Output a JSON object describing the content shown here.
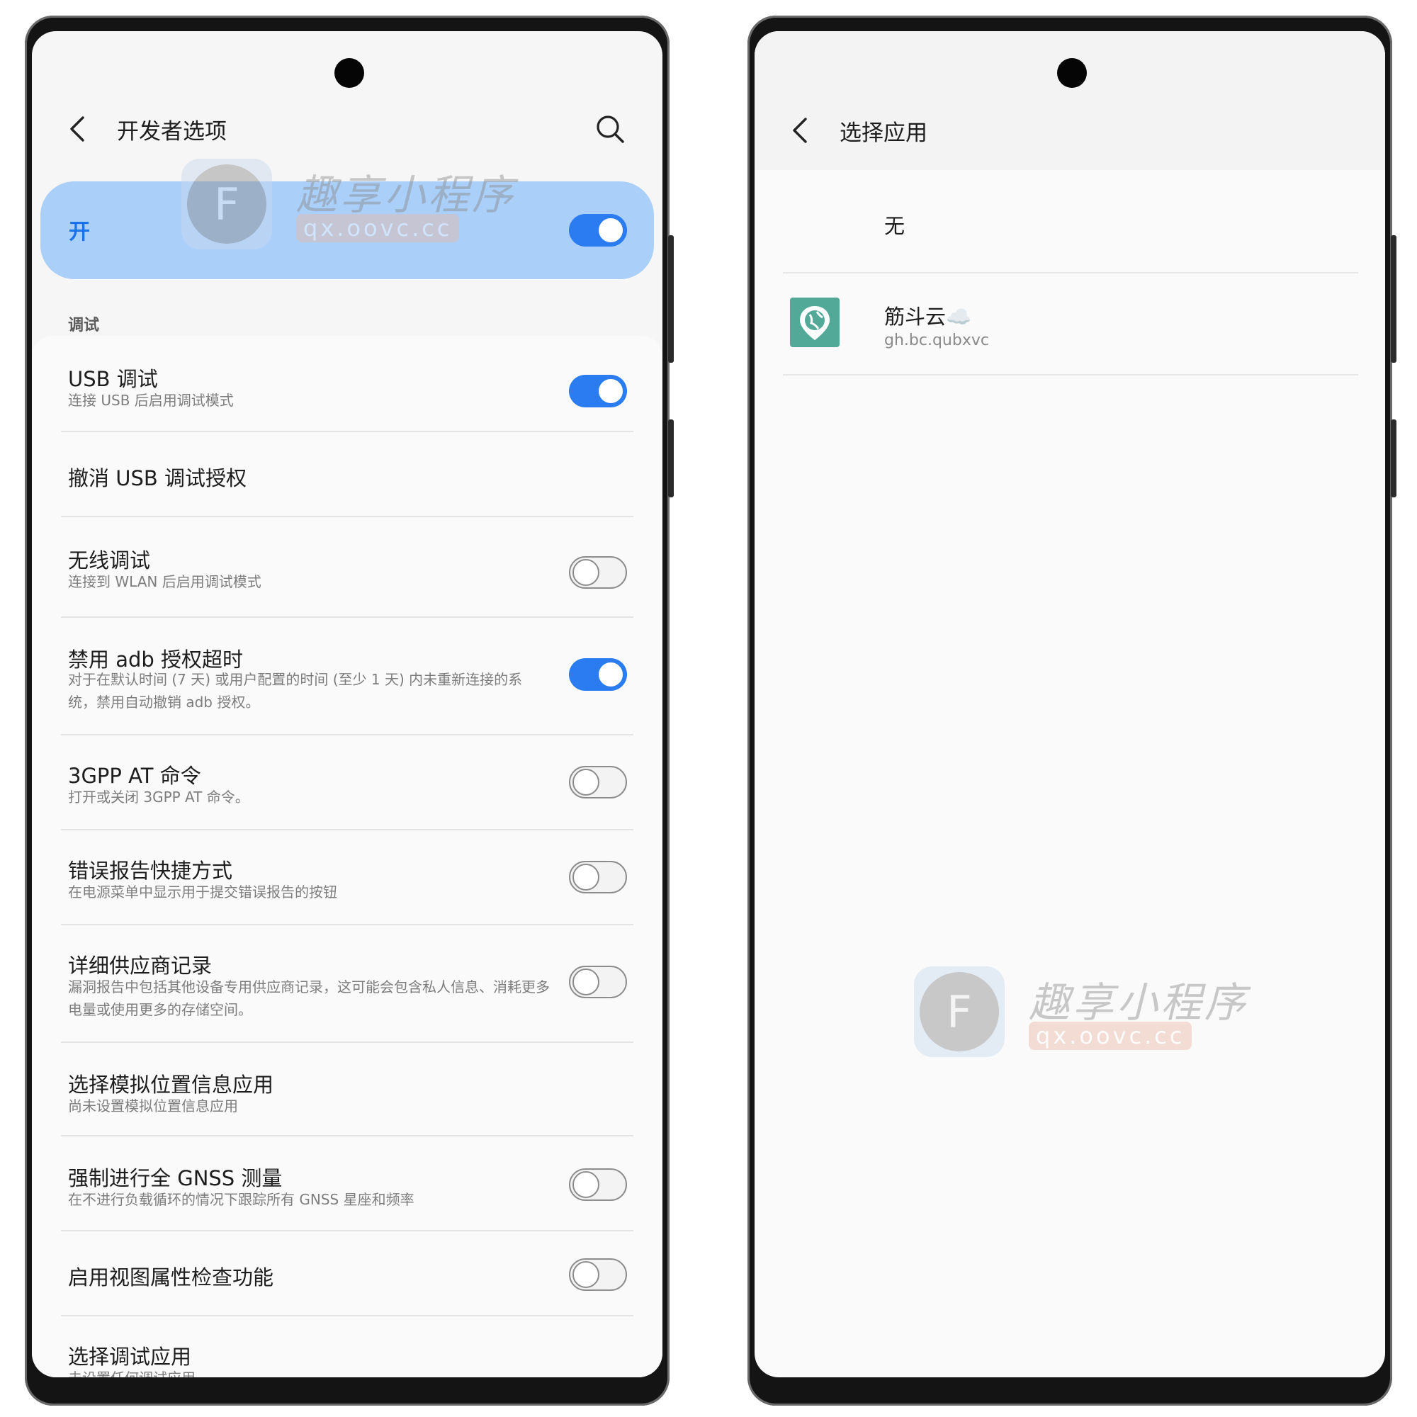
{
  "left": {
    "title": "开发者选项",
    "master_label": "开",
    "section_header": "调试",
    "items": [
      {
        "title": "USB 调试",
        "subtitle": "连接 USB 后启用调试模式"
      },
      {
        "title": "撤消 USB 调试授权"
      },
      {
        "title": "无线调试",
        "subtitle": "连接到 WLAN 后启用调试模式"
      },
      {
        "title": "禁用 adb 授权超时",
        "subtitle": "对于在默认时间 (7 天) 或用户配置的时间 (至少 1 天) 内未重新连接的系统，禁用自动撤销 adb 授权。"
      },
      {
        "title": "3GPP AT 命令",
        "subtitle": "打开或关闭 3GPP AT 命令。"
      },
      {
        "title": "错误报告快捷方式",
        "subtitle": "在电源菜单中显示用于提交错误报告的按钮"
      },
      {
        "title": "详细供应商记录",
        "subtitle": "漏洞报告中包括其他设备专用供应商记录，这可能会包含私人信息、消耗更多电量或使用更多的存储空间。"
      },
      {
        "title": "选择模拟位置信息应用",
        "subtitle": "尚未设置模拟位置信息应用"
      },
      {
        "title": "强制进行全 GNSS 测量",
        "subtitle": "在不进行负载循环的情况下跟踪所有 GNSS 星座和频率"
      },
      {
        "title": "启用视图属性检查功能"
      },
      {
        "title": "选择调试应用",
        "subtitle": "未设置任何调试应用"
      }
    ]
  },
  "right": {
    "title": "选择应用",
    "none_option": "无",
    "app": {
      "name": "筋斗云☁️",
      "package": "gh.bc.qubxvc"
    }
  },
  "watermark": {
    "name": "趣享小程序",
    "url": "qx.oovc.cc",
    "letter": "F"
  },
  "colors": {
    "accent": "#2a7cf0",
    "master_bg": "#aacff9",
    "app_icon": "#52a998"
  },
  "icons": {
    "back": "chevron-left-icon",
    "search": "search-icon",
    "app": "map-pin-globe-icon"
  },
  "toggles": {
    "master": true,
    "usb_debug": true,
    "wireless_debug": false,
    "adb_timeout": false,
    "at_commands": false,
    "bugreport_shortcut": false,
    "vendor_logging": false,
    "gnss": false,
    "view_attr": false
  }
}
